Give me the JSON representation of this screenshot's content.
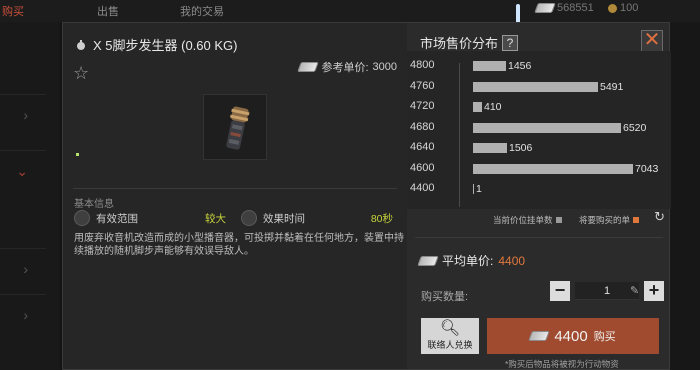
{
  "background": {
    "tabs": [
      {
        "label": "购买",
        "active": true
      },
      {
        "label": "出售",
        "active": false
      },
      {
        "label": "我的交易",
        "active": false
      }
    ],
    "currency_cash": "568551",
    "currency_coin": "100"
  },
  "item": {
    "title": "X 5脚步发生器 (0.60 KG)",
    "reference_price_label": "参考单价:",
    "reference_price": "3000",
    "basic_info_label": "基本信息",
    "attributes": [
      {
        "name": "有效范围",
        "value": "较大",
        "icon": "range-icon"
      },
      {
        "name": "效果时间",
        "value": "80秒",
        "icon": "timer-icon"
      }
    ],
    "description": "用废弃收音机改造而成的小型播音器，可投掷并黏着在任何地方，装置中持续播放的随机脚步声能够有效误导敌人。"
  },
  "market": {
    "title": "市场售价分布",
    "help_label": "?",
    "legend_current": "当前价位挂单数",
    "legend_mine": "将要购买的单",
    "avg_label": "平均单价:",
    "avg_value": "4400",
    "quantity_label": "购买数量:",
    "quantity_value": "1",
    "exchange_label": "联络人兑换",
    "buy_price": "4400",
    "buy_label": "购买",
    "note": "*购买后物品将被视为行动物资"
  },
  "chart_data": {
    "type": "bar",
    "orientation": "horizontal",
    "title": "市场售价分布",
    "categories": [
      "4800",
      "4760",
      "4720",
      "4680",
      "4640",
      "4600",
      "4400"
    ],
    "values": [
      1456,
      5491,
      410,
      6520,
      1506,
      7043,
      1
    ],
    "highlight_colors": {
      "current": "#b0b0b0",
      "mine": "#e0783c"
    }
  }
}
